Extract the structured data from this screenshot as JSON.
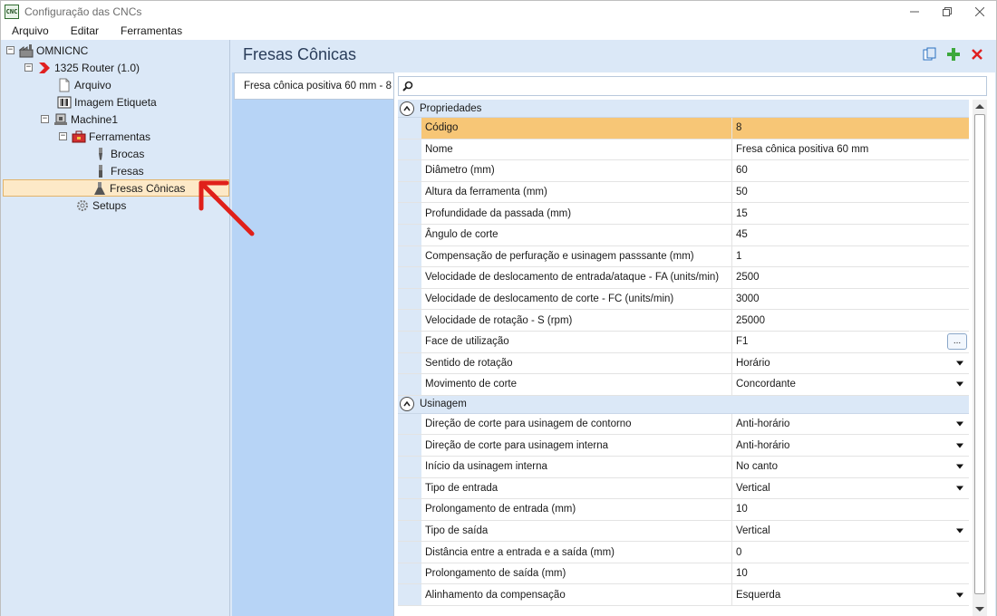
{
  "window": {
    "title": "Configuração das CNCs",
    "app_icon_text": "CNC"
  },
  "menu": [
    "Arquivo",
    "Editar",
    "Ferramentas"
  ],
  "tree": {
    "root": "OMNICNC",
    "router": "1325 Router (1.0)",
    "arquivo": "Arquivo",
    "imagem": "Imagem Etiqueta",
    "machine": "Machine1",
    "ferramentas": "Ferramentas",
    "brocas": "Brocas",
    "fresas": "Fresas",
    "fresas_conicas": "Fresas Cônicas",
    "setups": "Setups"
  },
  "panel": {
    "title": "Fresas Cônicas",
    "tab_label": "Fresa cônica positiva 60 mm - 8"
  },
  "categories": {
    "propriedades": "Propriedades",
    "usinagem": "Usinagem"
  },
  "properties": [
    {
      "name": "Código",
      "value": "8",
      "type": "text"
    },
    {
      "name": "Nome",
      "value": "Fresa cônica positiva 60 mm",
      "type": "text"
    },
    {
      "name": "Diâmetro (mm)",
      "value": "60",
      "type": "text"
    },
    {
      "name": "Altura da ferramenta (mm)",
      "value": "50",
      "type": "text"
    },
    {
      "name": "Profundidade da passada (mm)",
      "value": "15",
      "type": "text"
    },
    {
      "name": "Ângulo de corte",
      "value": "45",
      "type": "text"
    },
    {
      "name": "Compensação de perfuração e usinagem passsante (mm)",
      "value": "1",
      "type": "text"
    },
    {
      "name": "Velocidade de deslocamento de entrada/ataque - FA (units/min)",
      "value": "2500",
      "type": "text"
    },
    {
      "name": "Velocidade de deslocamento de corte - FC (units/min)",
      "value": "3000",
      "type": "text"
    },
    {
      "name": "Velocidade de rotação - S (rpm)",
      "value": "25000",
      "type": "text"
    },
    {
      "name": "Face de utilização",
      "value": "F1",
      "type": "ellipsis"
    },
    {
      "name": "Sentido de rotação",
      "value": "Horário",
      "type": "dropdown"
    },
    {
      "name": "Movimento de corte",
      "value": "Concordante",
      "type": "dropdown"
    }
  ],
  "usinagem": [
    {
      "name": "Direção de corte para usinagem de contorno",
      "value": "Anti-horário",
      "type": "dropdown"
    },
    {
      "name": "Direção de corte para usinagem interna",
      "value": "Anti-horário",
      "type": "dropdown"
    },
    {
      "name": "Início da usinagem interna",
      "value": "No canto",
      "type": "dropdown"
    },
    {
      "name": "Tipo de entrada",
      "value": "Vertical",
      "type": "dropdown"
    },
    {
      "name": "Prolongamento de entrada (mm)",
      "value": "10",
      "type": "text"
    },
    {
      "name": "Tipo de saída",
      "value": "Vertical",
      "type": "dropdown"
    },
    {
      "name": "Distância entre a entrada e a saída (mm)",
      "value": "0",
      "type": "text"
    },
    {
      "name": "Prolongamento de saída (mm)",
      "value": "10",
      "type": "text"
    },
    {
      "name": "Alinhamento da compensação",
      "value": "Esquerda",
      "type": "dropdown"
    }
  ],
  "ellipsis_label": "...",
  "colors": {
    "selection": "#f7c676",
    "tree_selection": "#fde9c7",
    "panel_bg": "#dbe8f7",
    "add_icon": "#3ca83c",
    "delete_icon": "#e02020",
    "arrow": "#e0201a"
  }
}
